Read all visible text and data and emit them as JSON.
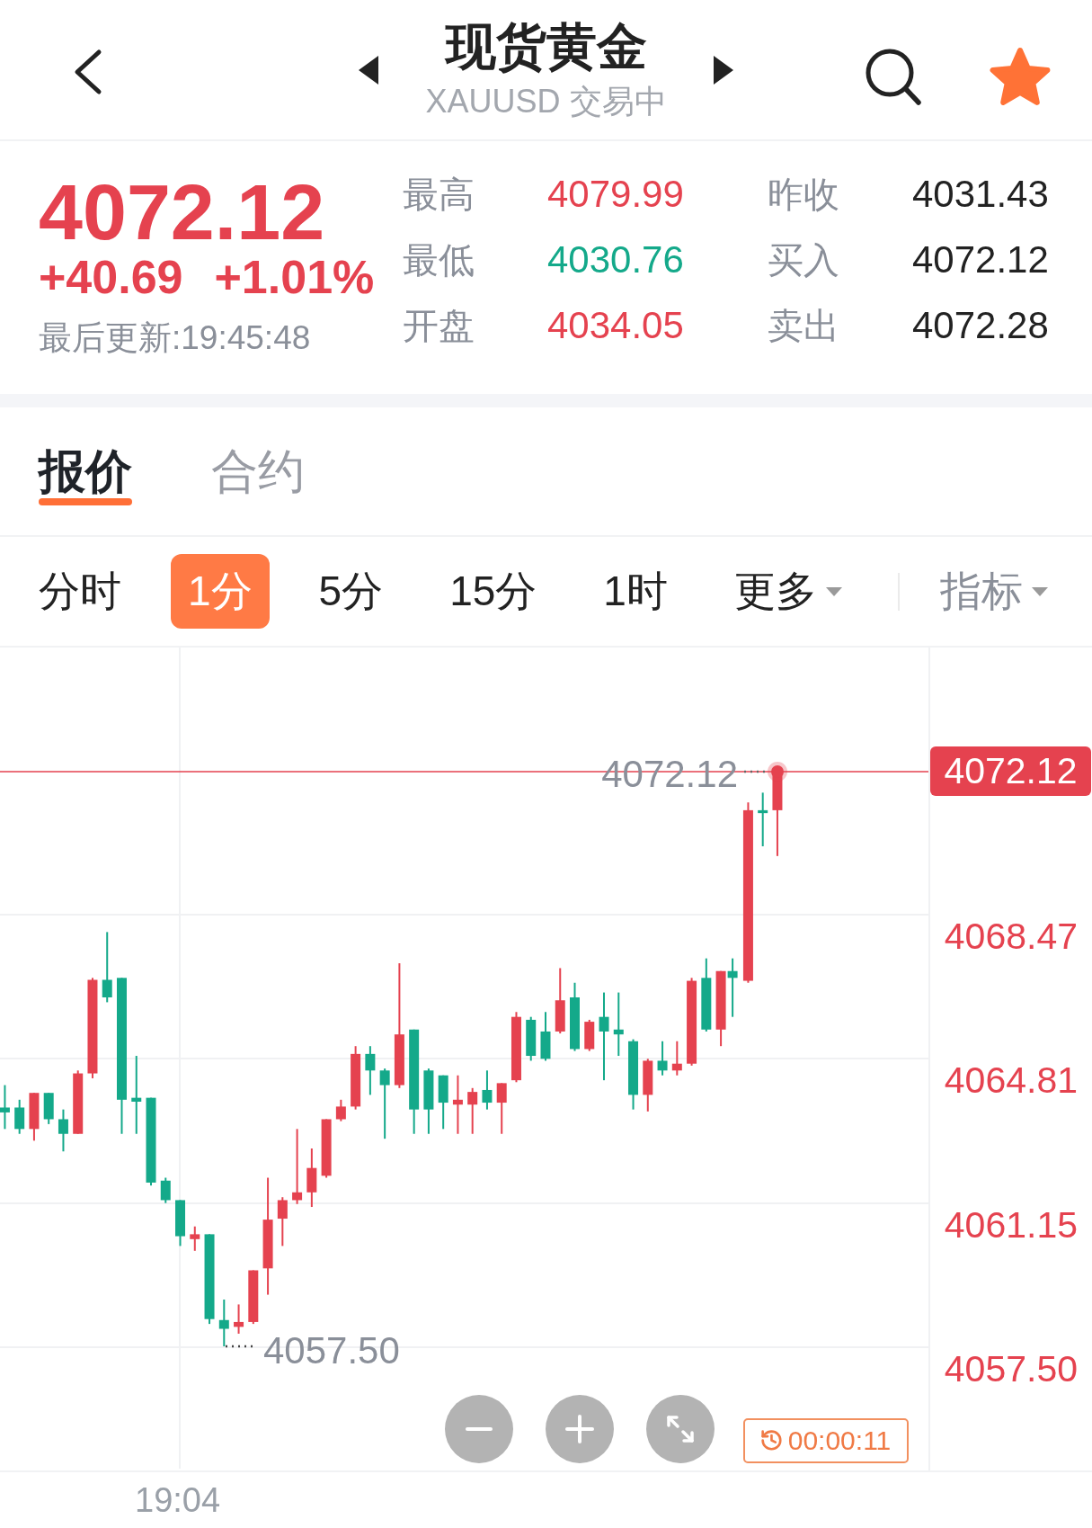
{
  "header": {
    "title": "现货黄金",
    "subtitle": "XAUUSD 交易中",
    "favorite": true
  },
  "quote": {
    "price": "4072.12",
    "change": "+40.69",
    "change_percent": "+1.01%",
    "updated": "最后更新:19:45:48"
  },
  "stats": [
    {
      "label": "最高",
      "value": "4079.99",
      "color": "#e5424f"
    },
    {
      "label": "昨收",
      "value": "4031.43",
      "color": "#222222"
    },
    {
      "label": "最低",
      "value": "4030.76",
      "color": "#14a98a"
    },
    {
      "label": "买入",
      "value": "4072.12",
      "color": "#222222"
    },
    {
      "label": "开盘",
      "value": "4034.05",
      "color": "#e5424f"
    },
    {
      "label": "卖出",
      "value": "4072.28",
      "color": "#222222"
    }
  ],
  "tabs": [
    {
      "label": "报价",
      "selected": true
    },
    {
      "label": "合约",
      "selected": false
    }
  ],
  "periods": [
    {
      "label": "分时",
      "kind": "option",
      "selected": false
    },
    {
      "label": "1分",
      "kind": "option",
      "selected": true
    },
    {
      "label": "5分",
      "kind": "option",
      "selected": false
    },
    {
      "label": "15分",
      "kind": "option",
      "selected": false
    },
    {
      "label": "1时",
      "kind": "option",
      "selected": false
    },
    {
      "label": "更多",
      "kind": "menu",
      "selected": false
    }
  ],
  "indicator": {
    "label": "指标",
    "kind": "menu"
  },
  "chart": {
    "last_price": "4072.12",
    "high_label": "4072.12",
    "low_label": "4057.50",
    "y_labels": [
      "4068.47",
      "4064.81",
      "4061.15",
      "4057.50"
    ],
    "x_labels": [
      "19:04"
    ],
    "timer": "00:00:11"
  }
}
